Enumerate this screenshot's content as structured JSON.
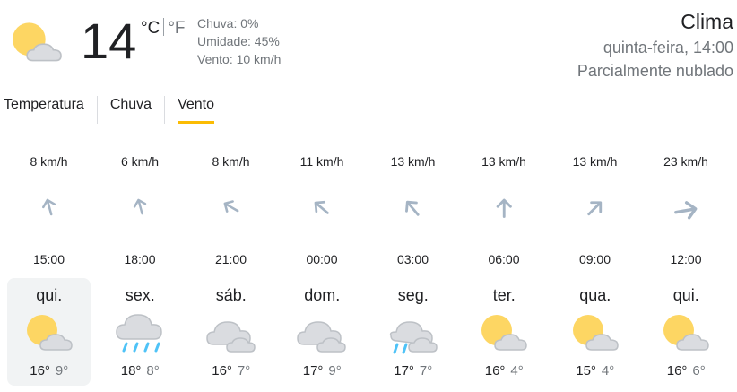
{
  "current": {
    "temperature": "14",
    "unit_c": "°C",
    "unit_f": "°F",
    "icon": "partly-cloudy-icon",
    "precipitation": "Chuva: 0%",
    "humidity": "Umidade: 45%",
    "wind": "Vento: 10 km/h"
  },
  "header": {
    "title": "Clima",
    "datetime": "quinta-feira, 14:00",
    "condition": "Parcialmente nublado"
  },
  "tabs": [
    {
      "label": "Temperatura",
      "active": false
    },
    {
      "label": "Chuva",
      "active": false
    },
    {
      "label": "Vento",
      "active": true
    }
  ],
  "wind": [
    {
      "speed": "8 km/h",
      "time": "15:00",
      "direction_deg": -15
    },
    {
      "speed": "6 km/h",
      "time": "18:00",
      "direction_deg": -15
    },
    {
      "speed": "8 km/h",
      "time": "21:00",
      "direction_deg": -60
    },
    {
      "speed": "11 km/h",
      "time": "00:00",
      "direction_deg": -50
    },
    {
      "speed": "13 km/h",
      "time": "03:00",
      "direction_deg": -40
    },
    {
      "speed": "13 km/h",
      "time": "06:00",
      "direction_deg": 0
    },
    {
      "speed": "13 km/h",
      "time": "09:00",
      "direction_deg": 45
    },
    {
      "speed": "23 km/h",
      "time": "12:00",
      "direction_deg": 80
    }
  ],
  "days": [
    {
      "name": "qui.",
      "hi": "16°",
      "lo": "9°",
      "icon": "partly-cloudy-icon",
      "selected": true
    },
    {
      "name": "sex.",
      "hi": "18°",
      "lo": "8°",
      "icon": "rain-icon",
      "selected": false
    },
    {
      "name": "sáb.",
      "hi": "16°",
      "lo": "7°",
      "icon": "cloudy-icon",
      "selected": false
    },
    {
      "name": "dom.",
      "hi": "17°",
      "lo": "9°",
      "icon": "cloudy-icon",
      "selected": false
    },
    {
      "name": "seg.",
      "hi": "17°",
      "lo": "7°",
      "icon": "showers-icon",
      "selected": false
    },
    {
      "name": "ter.",
      "hi": "16°",
      "lo": "4°",
      "icon": "partly-cloudy-icon",
      "selected": false
    },
    {
      "name": "qua.",
      "hi": "15°",
      "lo": "4°",
      "icon": "partly-cloudy-icon",
      "selected": false
    },
    {
      "name": "qui.",
      "hi": "16°",
      "lo": "6°",
      "icon": "partly-cloudy-icon",
      "selected": false
    }
  ],
  "colors": {
    "sun": "#fdd663",
    "cloud": "#dadce0",
    "cloud_stroke": "#bdc1c6",
    "rain": "#4fc3f7",
    "arrow": "#a5b4c4",
    "tab_underline": "#fbbc04"
  }
}
